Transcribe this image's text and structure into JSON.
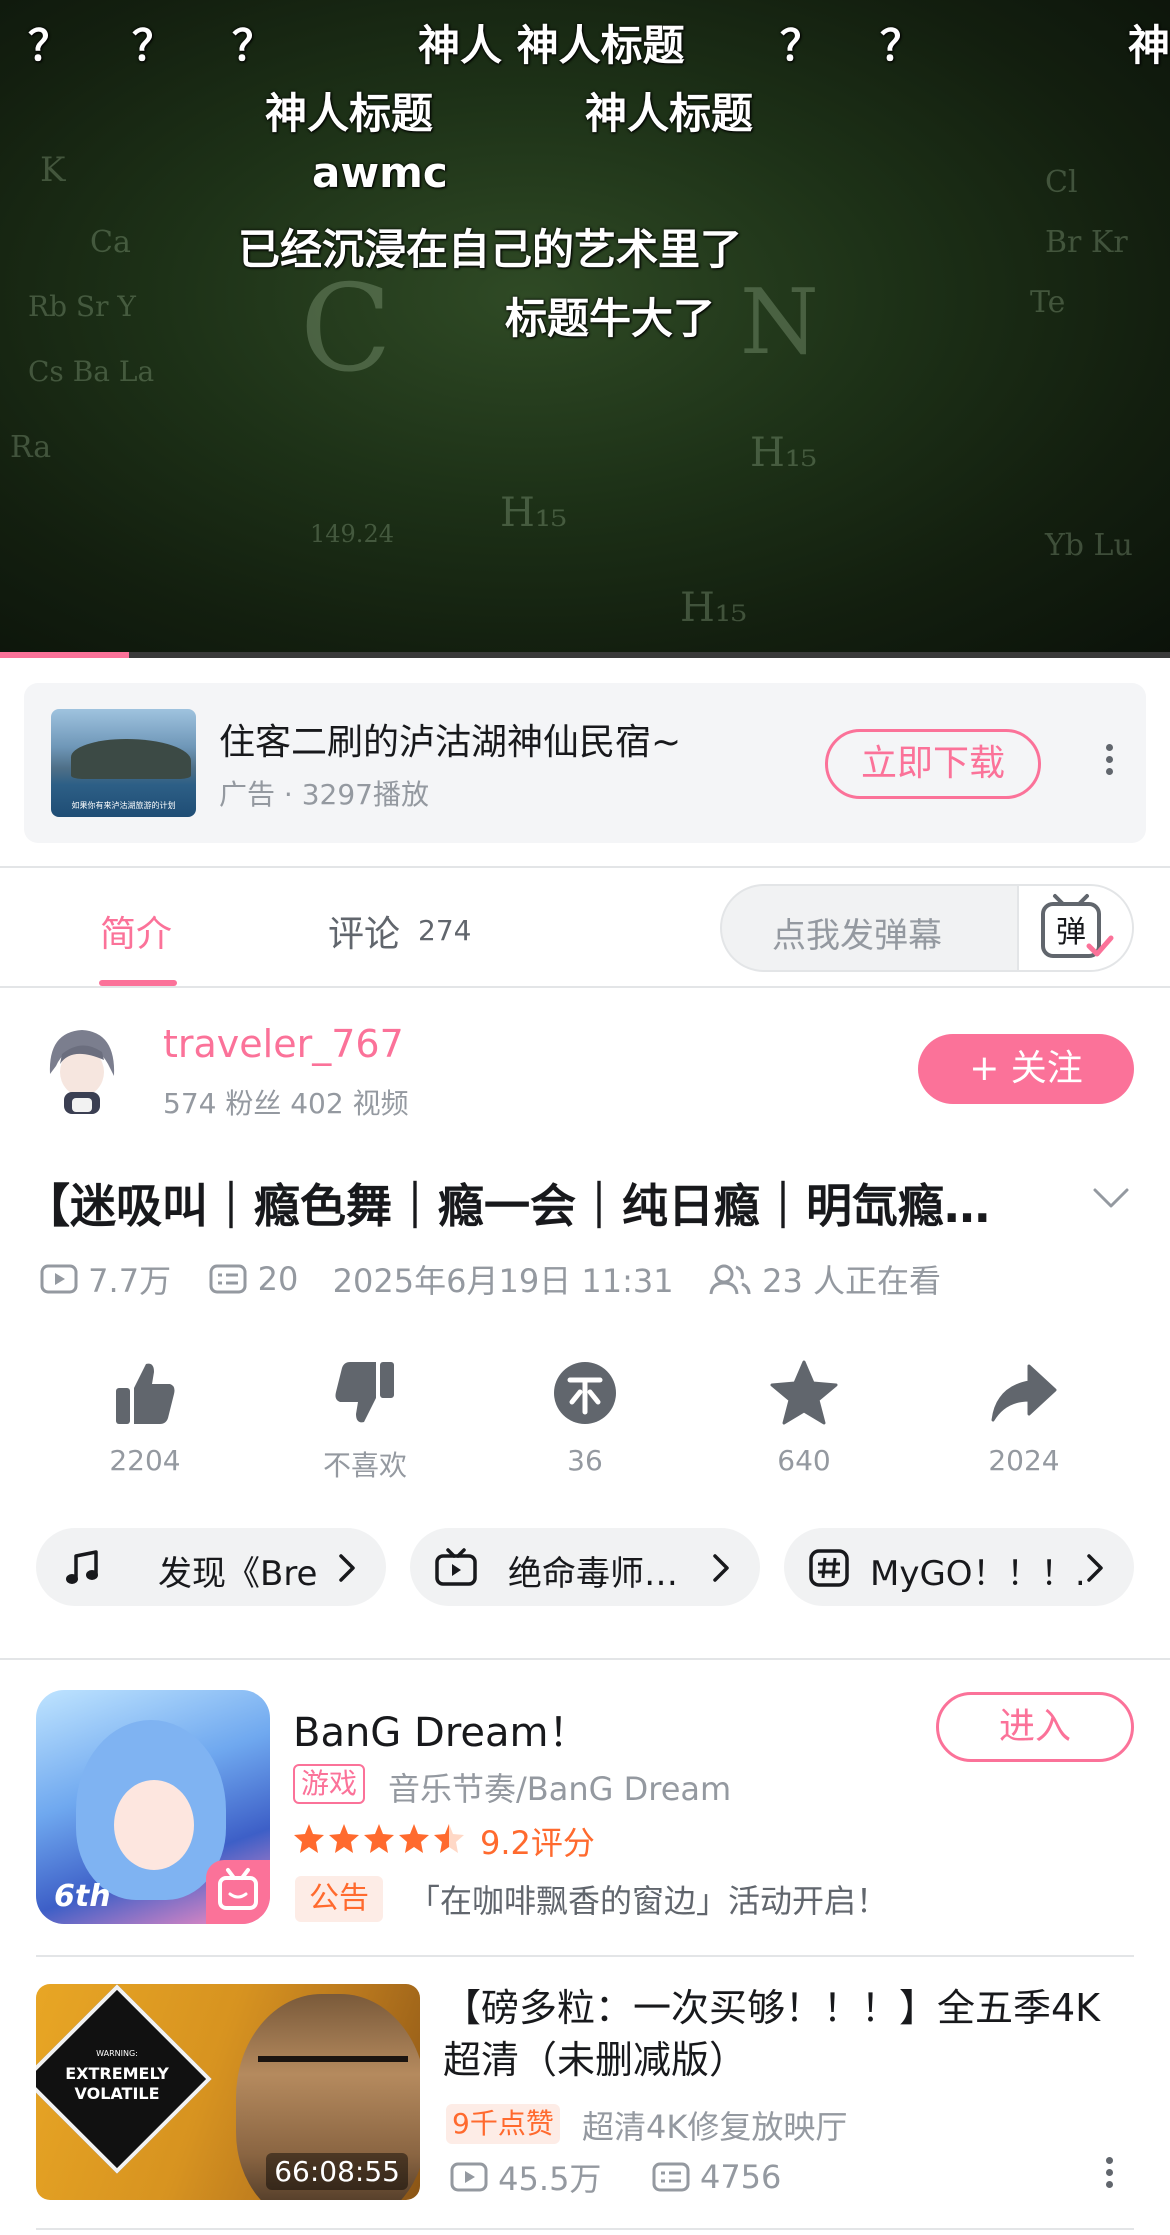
{
  "player": {
    "danmaku": [
      "？",
      "？",
      "？",
      "神人 神人标题",
      "？",
      "？",
      "神",
      "神人标题",
      "神人标题",
      "awmc",
      "已经沉浸在自己的艺术里了",
      "标题牛大了"
    ],
    "progress_fraction": 0.11,
    "colors": {
      "progress": "#fb7299"
    }
  },
  "ad": {
    "title": "住客二刷的泸沽湖神仙民宿~",
    "meta": "广告 · 3297播放",
    "thumb_caption": "如果你有来泸沽湖旅游的计划",
    "download_label": "立即下载"
  },
  "tabs": {
    "intro_label": "简介",
    "comments_label": "评论",
    "comments_count": "274",
    "danmu_placeholder": "点我发弹幕",
    "danmu_icon_char": "弹"
  },
  "uploader": {
    "name": "traveler_767",
    "stats": "574 粉丝   402 视频",
    "follow_label": "+ 关注"
  },
  "video": {
    "title": "【迷吸叫｜瘾色舞｜瘾一会｜纯日瘾｜明氙瘾…",
    "views": "7.7万",
    "danmaku_count": "20",
    "publish_time": "2025年6月19日 11:31",
    "watching": "23 人正在看"
  },
  "actions": {
    "like": "2204",
    "dislike": "不喜欢",
    "coin": "36",
    "favorite": "640",
    "share": "2024"
  },
  "chips": [
    {
      "icon": "music-note-icon",
      "text": "发现《Bre"
    },
    {
      "icon": "tv-icon",
      "text": "绝命毒师…"
    },
    {
      "icon": "hashtag-icon",
      "text": "MyGO！！！…"
    }
  ],
  "game": {
    "name": "BanG  Dream！",
    "tag": "游戏",
    "category": "音乐节奏/BanG  Dream",
    "rating": 4.5,
    "score": "9.2评分",
    "notice_tag": "公告",
    "notice": "「在咖啡飘香的窗边」活动开启！",
    "enter_label": "进入",
    "icon_text": "6th"
  },
  "recommended": {
    "title": "【磅多粒：一次买够！！！】全五季4K超清（未删减版）",
    "badge": "9千点赞",
    "source": "超清4K修复放映厅",
    "views": "45.5万",
    "danmaku": "4756",
    "duration": "66:08:55",
    "thumb_warning": "WARNING:",
    "thumb_headline": "EXTREMELY VOLATILE"
  },
  "colors": {
    "accent": "#fb7299",
    "text_primary": "#18191c",
    "text_secondary": "#9499a0",
    "rating": "#ff6a2e"
  }
}
